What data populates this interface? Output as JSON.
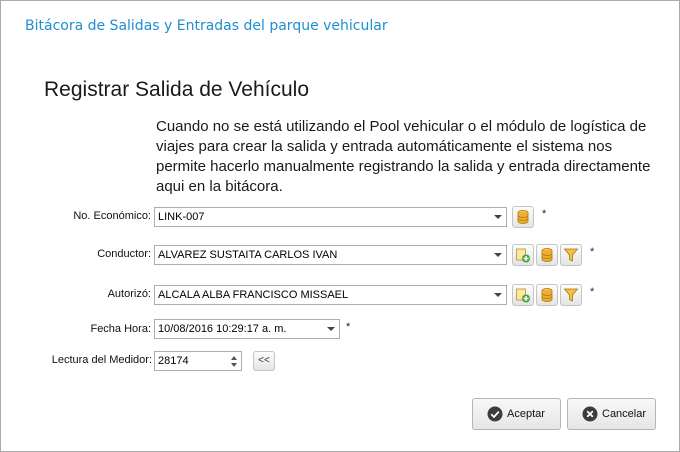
{
  "window": {
    "title": "Bitácora de Salidas y Entradas del parque vehicular"
  },
  "form": {
    "heading": "Registrar Salida de Vehículo",
    "description": "Cuando no se está utilizando el Pool vehicular o el módulo de logística de viajes para crear la salida y entrada automáticamente el sistema nos permite hacerlo manualmente registrando la salida y entrada directamente aqui en la bitácora.",
    "required_mark": "*",
    "fields": {
      "economico": {
        "label": "No. Económico:",
        "value": "LINK-007"
      },
      "conductor": {
        "label": "Conductor:",
        "value": "ALVAREZ SUSTAITA CARLOS IVAN"
      },
      "autorizo": {
        "label": "Autorizó:",
        "value": "ALCALA ALBA FRANCISCO MISSAEL"
      },
      "fecha_hora": {
        "label": "Fecha Hora:",
        "value": "10/08/2016 10:29:17 a. m."
      },
      "lectura": {
        "label": "Lectura del Medidor:",
        "value": "28174",
        "copy_button": "<<"
      }
    }
  },
  "buttons": {
    "accept": "Aceptar",
    "cancel": "Cancelar"
  },
  "icons": [
    "database-icon",
    "add-record-icon",
    "filter-icon",
    "check-circle-icon",
    "cancel-circle-icon"
  ]
}
